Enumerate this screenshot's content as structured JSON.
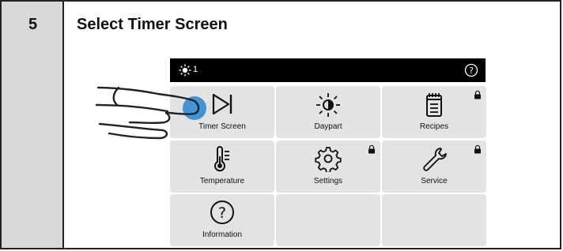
{
  "step": {
    "number": "5",
    "title": "Select Timer Screen"
  },
  "topbar": {
    "brightness_icon": "brightness-icon",
    "brightness_level": "1",
    "help_icon": "help-circle-icon"
  },
  "tiles": [
    {
      "label": "Timer Screen",
      "icon": "timer-skip-icon",
      "locked": false,
      "pressed": true
    },
    {
      "label": "Daypart",
      "icon": "daypart-sun-icon",
      "locked": false
    },
    {
      "label": "Recipes",
      "icon": "recipes-clipboard-icon",
      "locked": true
    },
    {
      "label": "Temperature",
      "icon": "thermometer-icon",
      "locked": false
    },
    {
      "label": "Settings",
      "icon": "gear-icon",
      "locked": true
    },
    {
      "label": "Service",
      "icon": "wrench-icon",
      "locked": true
    },
    {
      "label": "Information",
      "icon": "question-circle-icon",
      "locked": false
    },
    {
      "label": "",
      "icon": "",
      "locked": false
    },
    {
      "label": "",
      "icon": "",
      "locked": false
    }
  ],
  "colors": {
    "accent_press": "#3a8fd6",
    "topbar": "#000000",
    "tile": "#e3e3e3",
    "step_column": "#d9d9d9"
  }
}
